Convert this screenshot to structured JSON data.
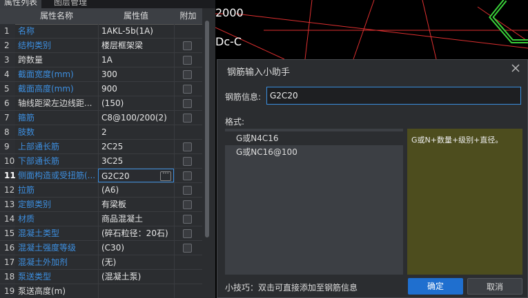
{
  "tabs": [
    "属性列表",
    "图层管理"
  ],
  "table": {
    "headers": [
      "属性名称",
      "属性值",
      "附加"
    ],
    "rows": [
      {
        "no": "1",
        "name": "名称",
        "value": "1AKL-5b(1A)",
        "color": "blue",
        "checkbox": false
      },
      {
        "no": "2",
        "name": "结构类别",
        "value": "楼层框架梁",
        "color": "blue",
        "checkbox": true
      },
      {
        "no": "3",
        "name": "跨数量",
        "value": "1A",
        "color": "white",
        "checkbox": true
      },
      {
        "no": "4",
        "name": "截面宽度(mm)",
        "value": "300",
        "color": "blue",
        "checkbox": true
      },
      {
        "no": "5",
        "name": "截面高度(mm)",
        "value": "900",
        "color": "blue",
        "checkbox": true
      },
      {
        "no": "6",
        "name": "轴线距梁左边线距...",
        "value": "(150)",
        "color": "white",
        "checkbox": true
      },
      {
        "no": "7",
        "name": "箍筋",
        "value": "C8@100/200(2)",
        "color": "blue",
        "checkbox": true
      },
      {
        "no": "8",
        "name": "肢数",
        "value": "2",
        "color": "blue",
        "checkbox": false
      },
      {
        "no": "9",
        "name": "上部通长筋",
        "value": "2C25",
        "color": "blue",
        "checkbox": true
      },
      {
        "no": "10",
        "name": "下部通长筋",
        "value": "3C25",
        "color": "blue",
        "checkbox": true
      },
      {
        "no": "11",
        "name": "侧面构造或受扭筋(...",
        "value": "G2C20",
        "color": "blue",
        "checkbox": true,
        "selected": true
      },
      {
        "no": "12",
        "name": "拉筋",
        "value": "(A6)",
        "color": "blue",
        "checkbox": true
      },
      {
        "no": "13",
        "name": "定额类别",
        "value": "有梁板",
        "color": "blue",
        "checkbox": true
      },
      {
        "no": "14",
        "name": "材质",
        "value": "商品混凝土",
        "color": "blue",
        "checkbox": true
      },
      {
        "no": "15",
        "name": "混凝土类型",
        "value": "(碎石粒径：20石)",
        "color": "blue",
        "checkbox": true
      },
      {
        "no": "16",
        "name": "混凝土强度等级",
        "value": "(C30)",
        "color": "blue",
        "checkbox": true
      },
      {
        "no": "17",
        "name": "混凝土外加剂",
        "value": "(无)",
        "color": "blue",
        "checkbox": false
      },
      {
        "no": "18",
        "name": "泵送类型",
        "value": "(混凝土泵)",
        "color": "blue",
        "checkbox": false
      },
      {
        "no": "19",
        "name": "泵送高度(m)",
        "value": "",
        "color": "white",
        "checkbox": false
      }
    ]
  },
  "cad": {
    "label_top": "2000",
    "label_axis": "Dc-C"
  },
  "dialog": {
    "title": "钢筋输入小助手",
    "info_label": "钢筋信息:",
    "info_value": "G2C20",
    "format_label": "格式:",
    "format_items": [
      "G或N4C16",
      "G或NC16@100"
    ],
    "format_desc": "G或N+数量+级别+直径。",
    "tip": "小技巧：双击可直接添加至钢筋信息",
    "ok": "确定",
    "cancel": "取消"
  }
}
